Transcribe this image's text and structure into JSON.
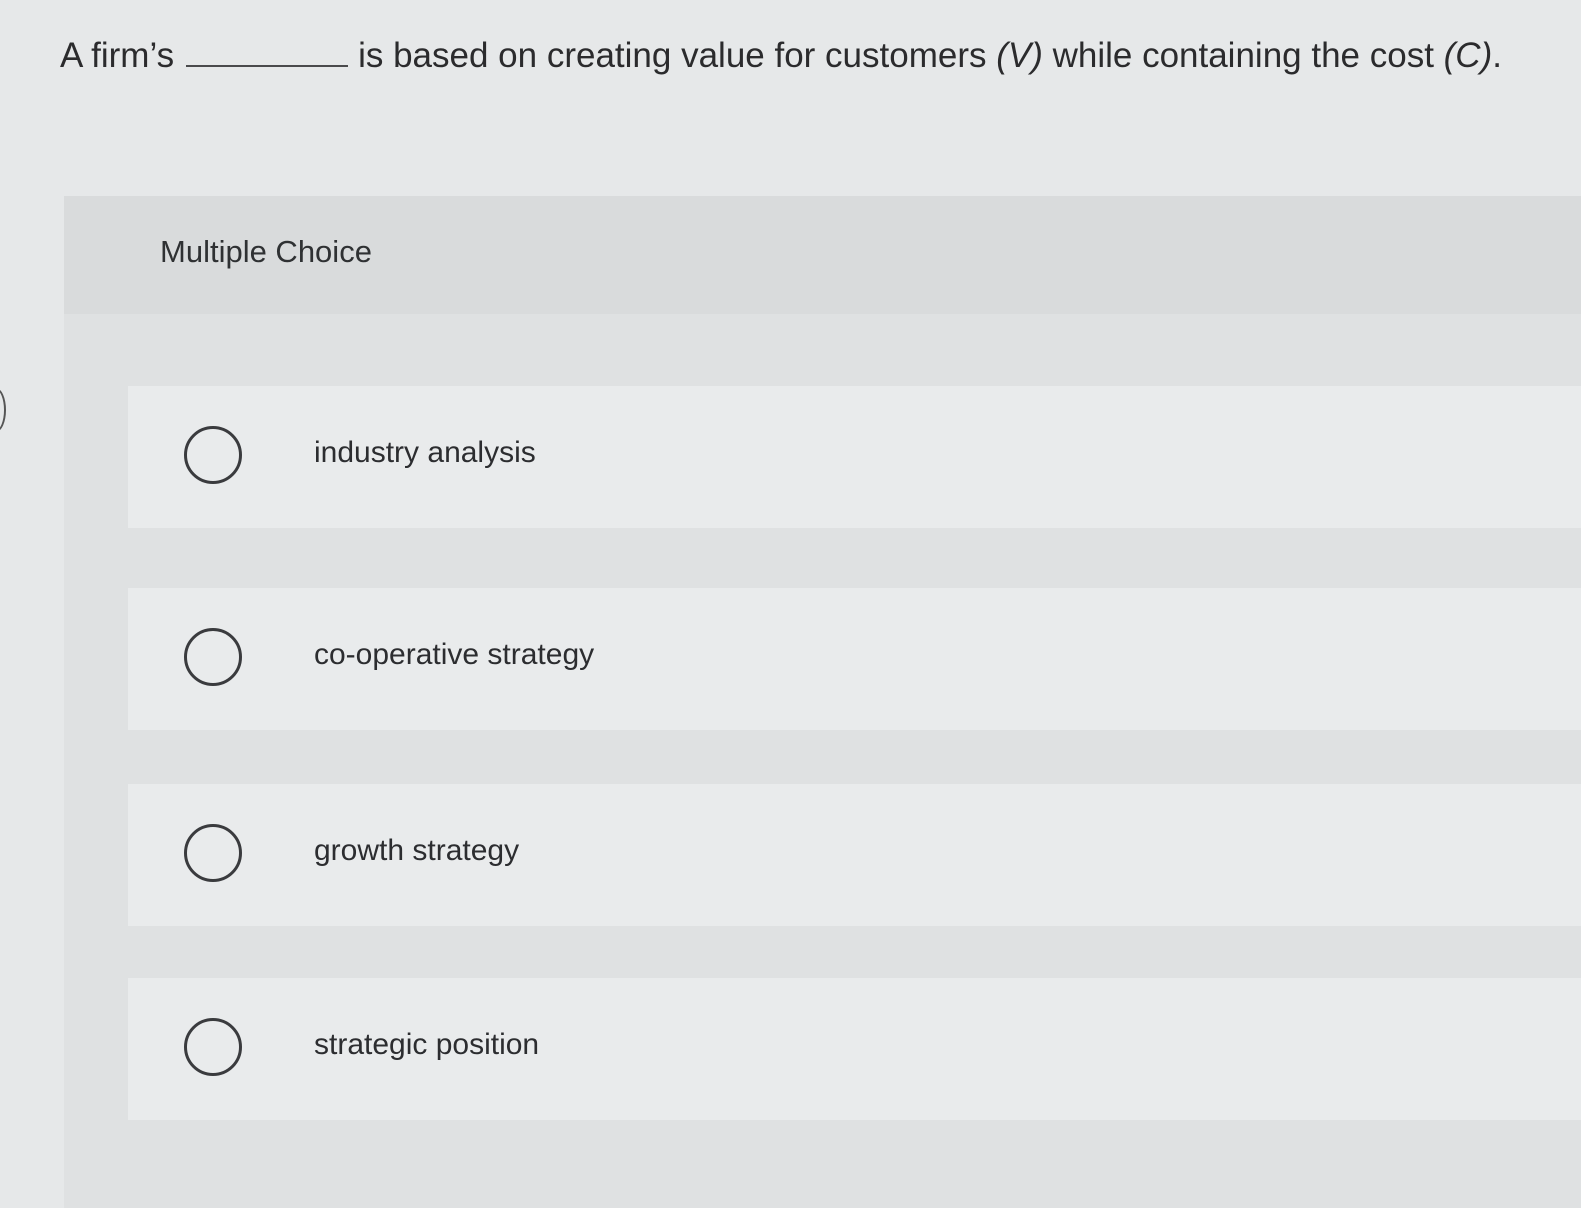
{
  "question": {
    "prefix": "A firm’s",
    "middle": "is based on creating value for customers ",
    "v_symbol": "(V)",
    "middle2": " while containing the cost ",
    "c_symbol": "(C)",
    "suffix": "."
  },
  "panel": {
    "label": "Multiple Choice"
  },
  "options": [
    {
      "label": "industry analysis",
      "selected": false
    },
    {
      "label": "co-operative strategy",
      "selected": false
    },
    {
      "label": "growth strategy",
      "selected": false
    },
    {
      "label": "strategic position",
      "selected": false
    }
  ]
}
